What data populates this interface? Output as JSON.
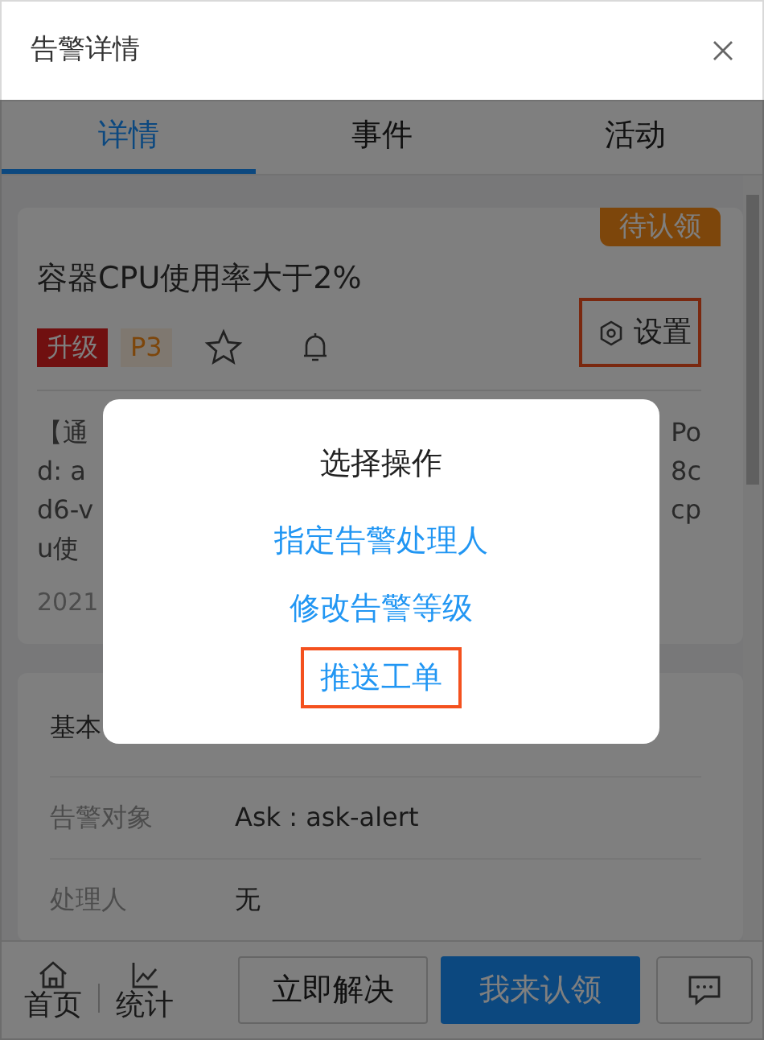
{
  "window": {
    "title": "告警详情"
  },
  "tabs": [
    {
      "label": "详情",
      "selected": true
    },
    {
      "label": "事件",
      "selected": false
    },
    {
      "label": "活动",
      "selected": false
    }
  ],
  "alert": {
    "status_tag": "待认领",
    "title": "容器CPU使用率大于2%",
    "settings": {
      "label": "设置",
      "highlighted": true
    },
    "tags": [
      {
        "label": "升级",
        "kind": "escalation"
      },
      {
        "label": "P3",
        "kind": "priority"
      }
    ],
    "starred": false,
    "description_lines": [
      {
        "left": "【通",
        "right": "Po"
      },
      {
        "left": "d: a",
        "right": "8c"
      },
      {
        "left": "d6-v",
        "right": "cp"
      },
      {
        "left": "u使"
      }
    ],
    "time": "2021"
  },
  "info": {
    "heading": "基本",
    "rows": [
      {
        "label": "告警对象",
        "value": "Ask : ask-alert"
      },
      {
        "label": "处理人",
        "value": "无"
      }
    ]
  },
  "bottom_nav": [
    {
      "label": "首页",
      "kind": "home"
    },
    {
      "label": "统计",
      "kind": "stats"
    }
  ],
  "actions": [
    {
      "label": "立即解决",
      "kind": "outline"
    },
    {
      "label": "我来认领",
      "kind": "primary"
    }
  ],
  "dialog": {
    "title": "选择操作",
    "options": [
      {
        "label": "指定告警处理人",
        "highlighted": false
      },
      {
        "label": "修改告警等级",
        "highlighted": false
      },
      {
        "label": "推送工单",
        "highlighted": true
      }
    ]
  }
}
